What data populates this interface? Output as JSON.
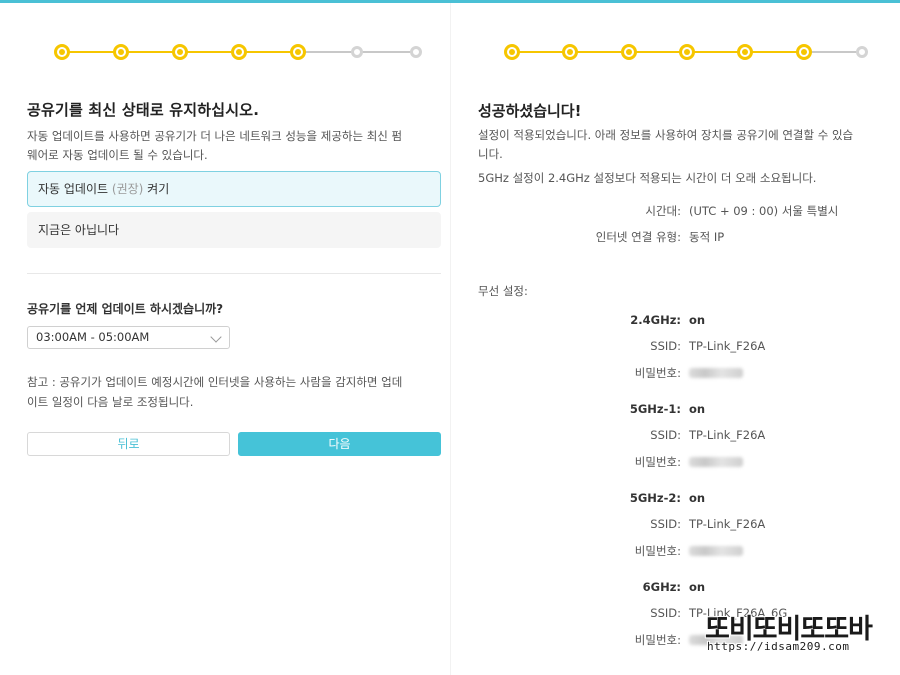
{
  "left": {
    "stepper": {
      "total": 7,
      "completed": 5
    },
    "title": "공유기를 최신 상태로 유지하십시오.",
    "description_line1": "자동 업데이트를 사용하면 공유기가 더 나은 네트워크 성능을 제공하는 최신 펌",
    "description_line2": "웨어로 자동 업데이트 될 수 있습니다.",
    "option_auto": {
      "label_main": "자동 업데이트",
      "label_hint": "(권장)",
      "label_tail": "켜기",
      "selected": true
    },
    "option_no": {
      "label": "지금은 아닙니다",
      "selected": false
    },
    "schedule_question": "공유기를 언제 업데이트 하시겠습니까?",
    "schedule_select": {
      "value": "03:00AM - 05:00AM"
    },
    "note_line1": "참고 : 공유기가 업데이트 예정시간에 인터넷을 사용하는 사람을 감지하면 업데",
    "note_line2": "이트 일정이 다음 날로 조정됩니다.",
    "back_label": "뒤로",
    "next_label": "다음"
  },
  "right": {
    "stepper": {
      "total": 7,
      "completed": 6
    },
    "title": "성공하셨습니다!",
    "description_line1": "설정이 적용되었습니다. 아래 정보를 사용하여 장치를 공유기에 연결할 수 있습",
    "description_line2": "니다.",
    "note": "5GHz 설정이 2.4GHz 설정보다 적용되는 시간이 더 오래 소요됩니다.",
    "timezone": {
      "key": "시간대:",
      "value": "(UTC + 09 : 00) 서울 특별시"
    },
    "conn_type": {
      "key": "인터넷 연결 유형:",
      "value": "동적 IP"
    },
    "wireless_label": "무선 설정:",
    "bands": [
      {
        "key": "2.4GHz:",
        "status": "on",
        "ssid_key": "SSID:",
        "ssid": "TP-Link_F26A",
        "pw_key": "비밀번호:"
      },
      {
        "key": "5GHz-1:",
        "status": "on",
        "ssid_key": "SSID:",
        "ssid": "TP-Link_F26A",
        "pw_key": "비밀번호:"
      },
      {
        "key": "5GHz-2:",
        "status": "on",
        "ssid_key": "SSID:",
        "ssid": "TP-Link_F26A",
        "pw_key": "비밀번호:"
      },
      {
        "key": "6GHz:",
        "status": "on",
        "ssid_key": "SSID:",
        "ssid": "TP-Link_F26A_6G",
        "pw_key": "비밀번호:"
      }
    ]
  },
  "watermark": {
    "text": "또비또비또또바",
    "url": "https://idsam209.com"
  },
  "colors": {
    "accent": "#45c3d8",
    "step_done": "#f6c600",
    "step_todo": "#c8c8c8"
  }
}
